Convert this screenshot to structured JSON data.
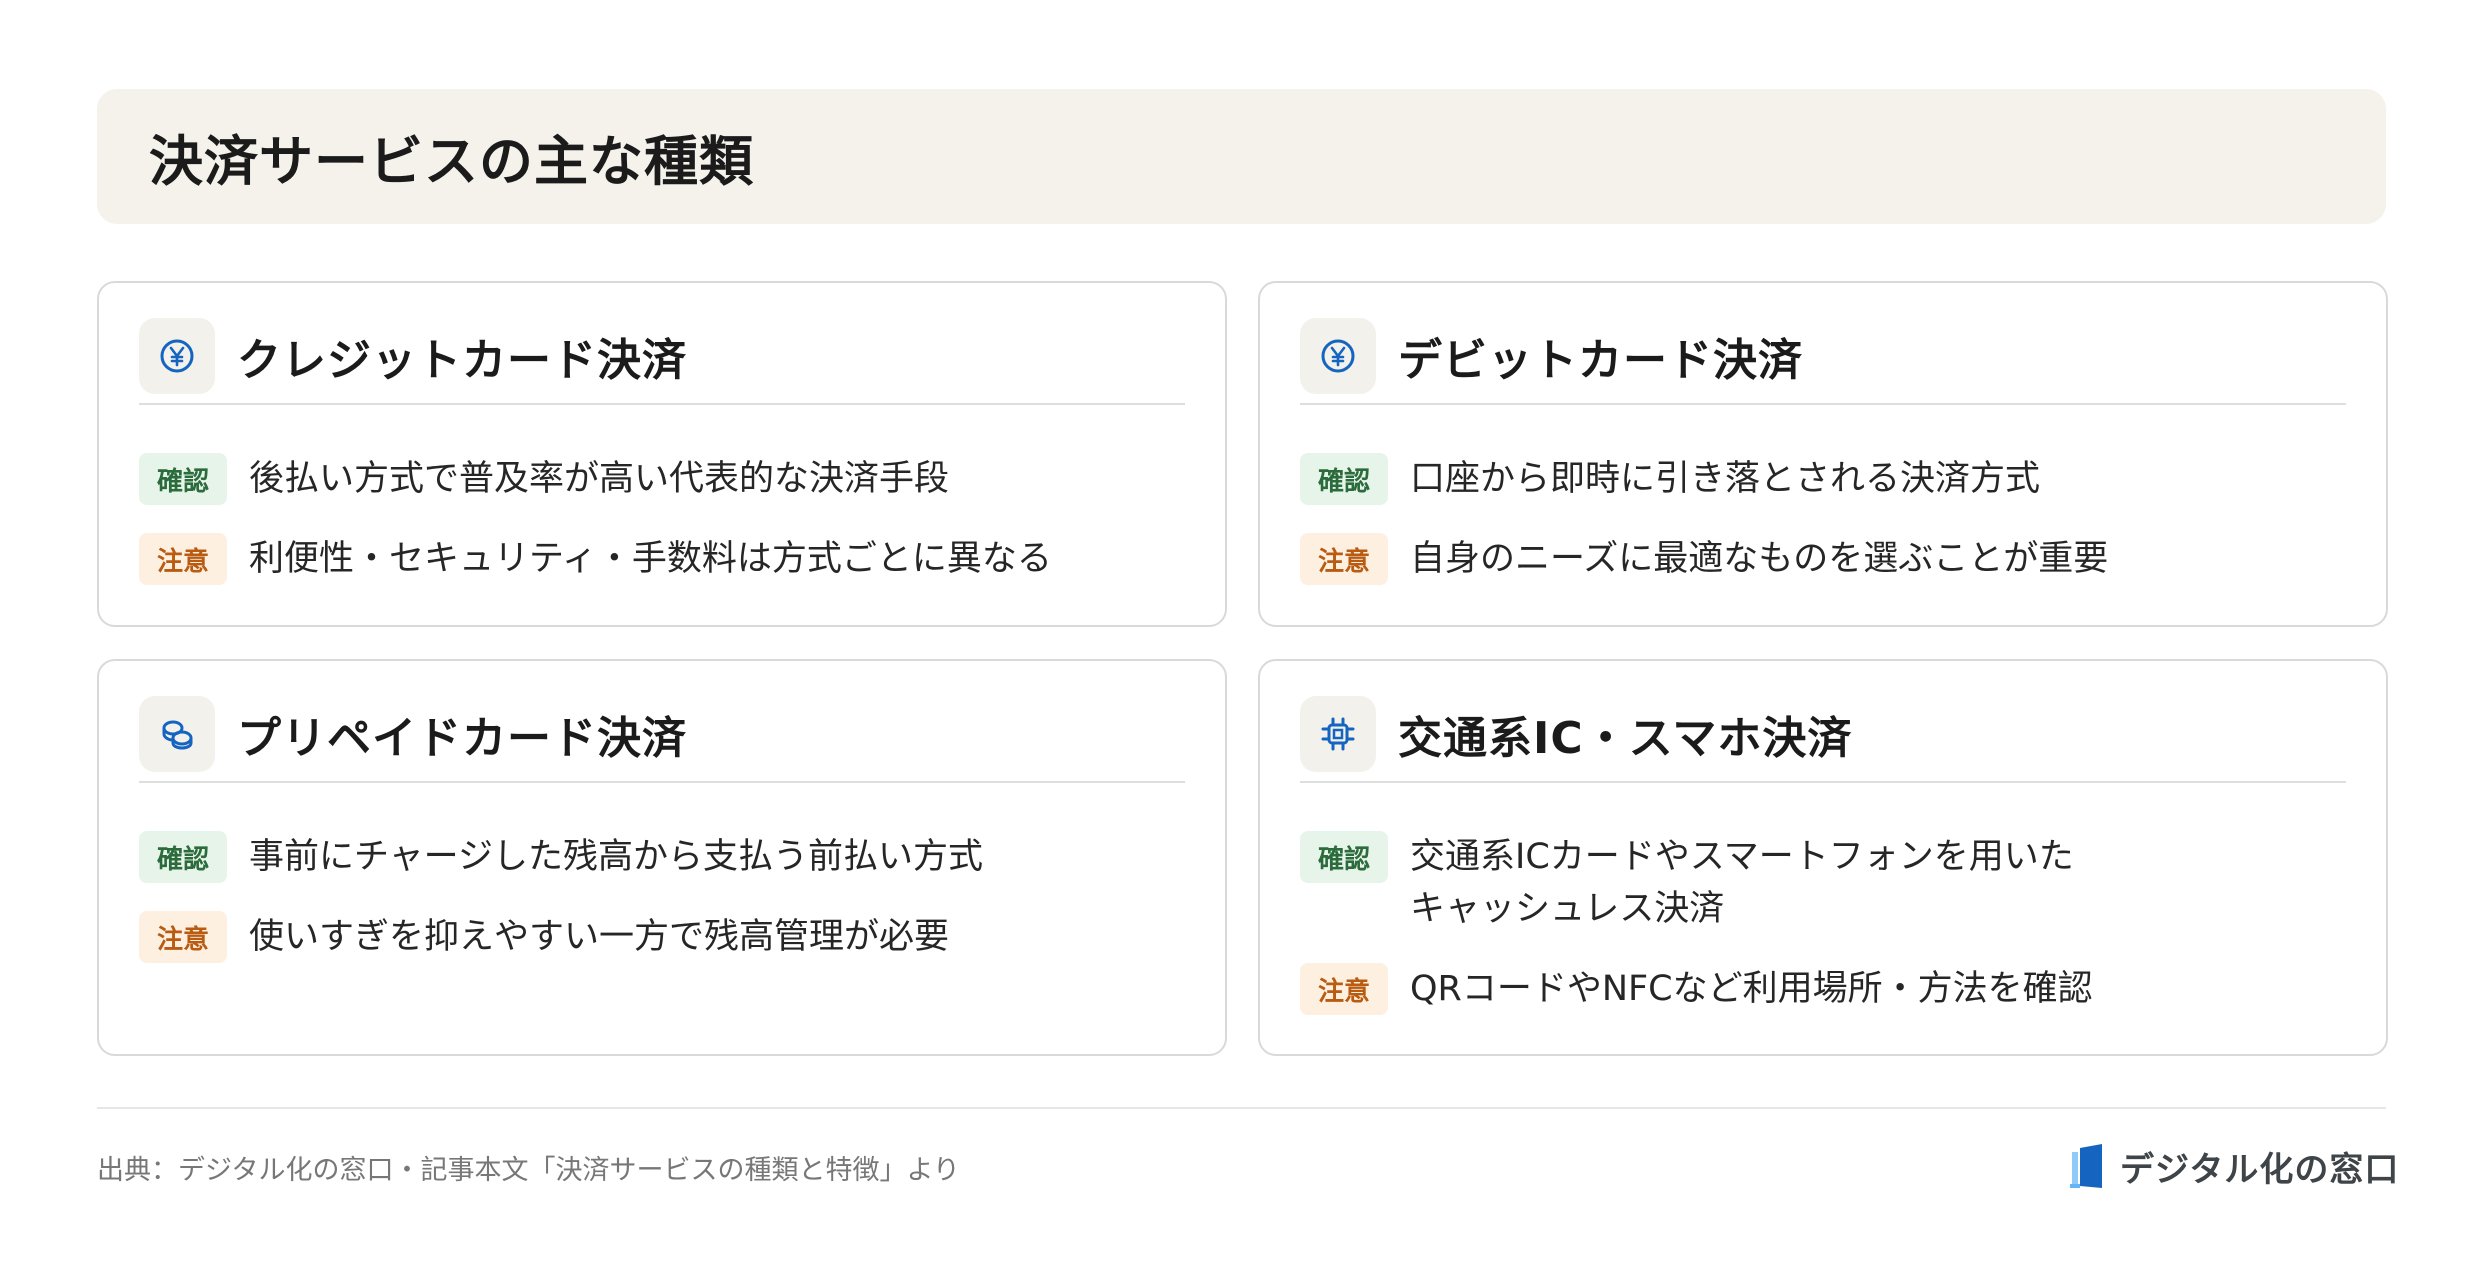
{
  "title": "決済サービスの主な種類",
  "cards": [
    {
      "icon": "yen-circle-icon",
      "title": "クレジットカード決済",
      "rows": [
        {
          "badge": "確認",
          "text": "後払い方式で普及率が高い代表的な決済手段"
        },
        {
          "badge": "注意",
          "text": "利便性・セキュリティ・手数料は方式ごとに異なる"
        }
      ]
    },
    {
      "icon": "yen-circle-icon",
      "title": "デビットカード決済",
      "rows": [
        {
          "badge": "確認",
          "text": "口座から即時に引き落とされる決済方式"
        },
        {
          "badge": "注意",
          "text": "自身のニーズに最適なものを選ぶことが重要"
        }
      ]
    },
    {
      "icon": "coins-icon",
      "title": "プリペイドカード決済",
      "rows": [
        {
          "badge": "確認",
          "text": "事前にチャージした残高から支払う前払い方式"
        },
        {
          "badge": "注意",
          "text": "使いすぎを抑えやすい一方で残高管理が必要"
        }
      ]
    },
    {
      "icon": "chip-icon",
      "title": "交通系IC・スマホ決済",
      "rows": [
        {
          "badge": "確認",
          "text": "交通系ICカードやスマートフォンを用いた\nキャッシュレス決済"
        },
        {
          "badge": "注意",
          "text": "QRコードやNFCなど利用場所・方法を確認"
        }
      ]
    }
  ],
  "footer": {
    "source": "出典：デジタル化の窓口・記事本文「決済サービスの種類と特徴」より",
    "logo_text": "デジタル化の窓口",
    "logo_icon": "door-logo-icon"
  },
  "colors": {
    "accent": "#1565c0",
    "badge_ok_bg": "#e7f4ea",
    "badge_ok_text": "#2b6b3c",
    "badge_warn_bg": "#fdf0e1",
    "badge_warn_text": "#b95c12"
  }
}
